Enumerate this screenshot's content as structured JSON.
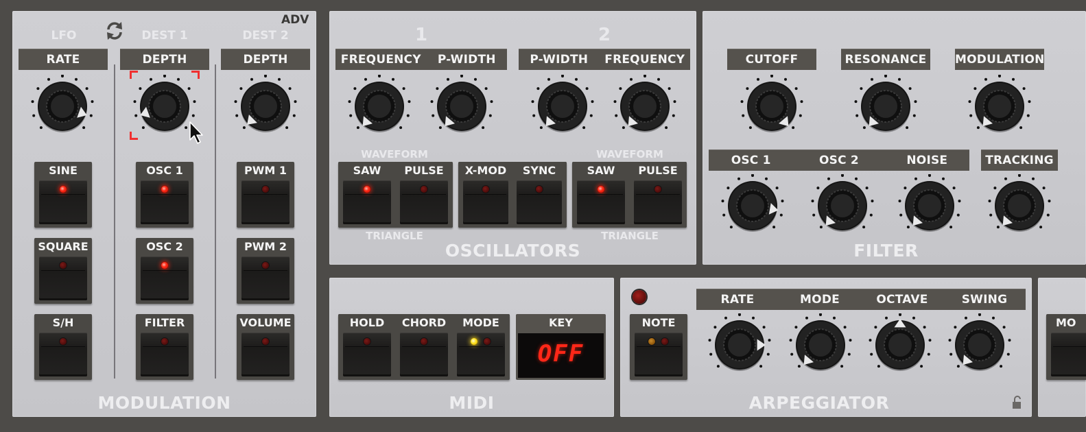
{
  "modulation": {
    "adv": "ADV",
    "col_lfo": "LFO",
    "col_dest1": "DEST 1",
    "col_dest2": "DEST 2",
    "hdr_rate": "RATE",
    "hdr_depth1": "DEPTH",
    "hdr_depth2": "DEPTH",
    "lfo_buttons": [
      "SINE",
      "SQUARE",
      "S/H"
    ],
    "dest1_buttons": [
      "OSC 1",
      "OSC 2",
      "FILTER"
    ],
    "dest2_buttons": [
      "PWM 1",
      "PWM 2",
      "VOLUME"
    ],
    "title": "MODULATION"
  },
  "oscillators": {
    "osc1_num": "1",
    "osc2_num": "2",
    "hdr1": [
      "FREQUENCY",
      "P-WIDTH"
    ],
    "hdr2": [
      "P-WIDTH",
      "FREQUENCY"
    ],
    "waveform_label": "WAVEFORM",
    "triangle_label": "TRIANGLE",
    "osc1_buttons": [
      "SAW",
      "PULSE"
    ],
    "mid_buttons": [
      "X-MOD",
      "SYNC"
    ],
    "osc2_buttons": [
      "SAW",
      "PULSE"
    ],
    "title": "OSCILLATORS"
  },
  "filter": {
    "hdr_top": [
      "CUTOFF",
      "RESONANCE",
      "MODULATION"
    ],
    "hdr_mix": [
      "OSC 1",
      "OSC 2",
      "NOISE"
    ],
    "hdr_tracking": "TRACKING",
    "title": "FILTER"
  },
  "midi": {
    "buttons": [
      "HOLD",
      "CHORD",
      "MODE"
    ],
    "key_label": "KEY",
    "key_value": "OFF",
    "title": "MIDI"
  },
  "arpeggiator": {
    "note_button": "NOTE",
    "hdr": [
      "RATE",
      "MODE",
      "OCTAVE",
      "SWING"
    ],
    "title": "ARPEGGIATOR"
  },
  "partial": {
    "button": "MO"
  },
  "colors": {
    "led_on": "#ff2a16",
    "led_yellow": "#ffe21e",
    "panel": "#c9c9cd",
    "header": "#55524d"
  }
}
